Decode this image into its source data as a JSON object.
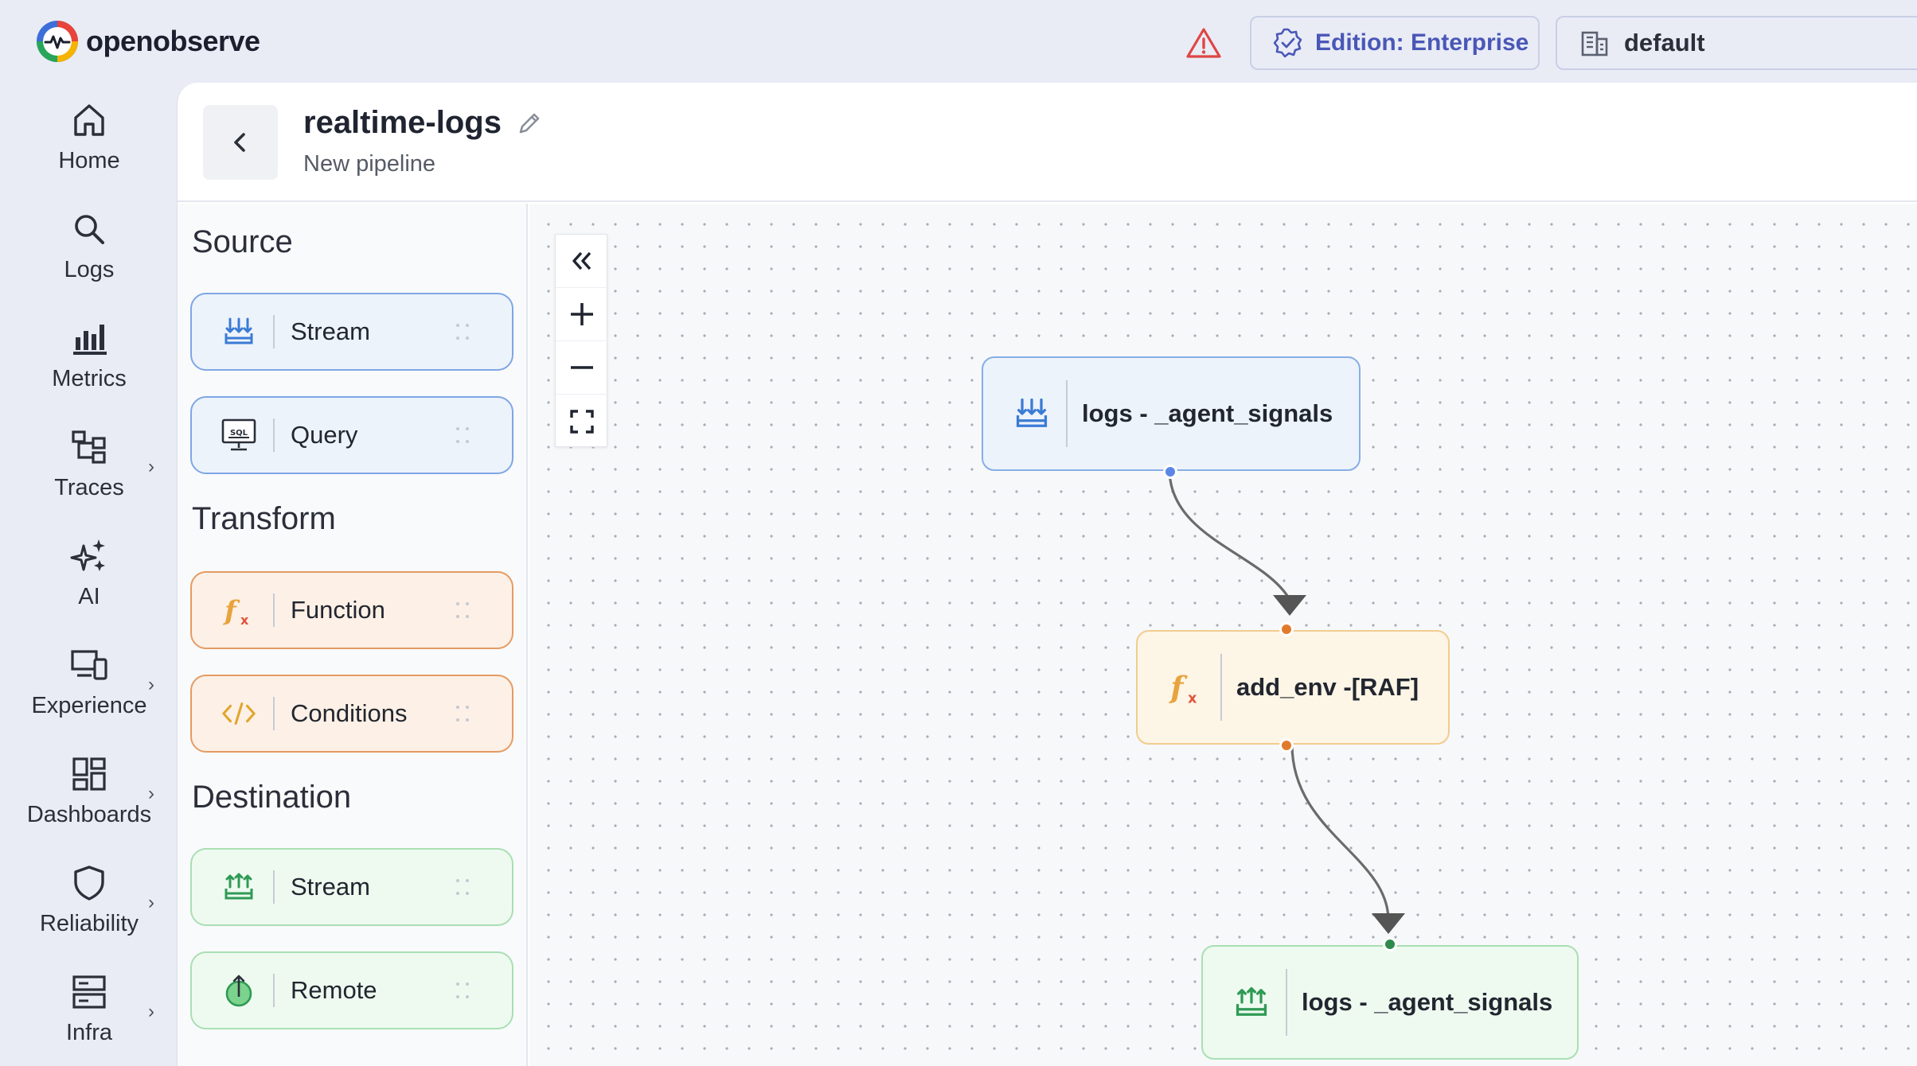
{
  "app": {
    "logo_text": "openobserve"
  },
  "topbar": {
    "alert_icon": "warning-triangle-icon",
    "edition_label": "Edition: Enterprise",
    "org_label": "default"
  },
  "nav": {
    "items": [
      {
        "label": "Home",
        "icon": "home-icon",
        "has_submenu": false
      },
      {
        "label": "Logs",
        "icon": "search-icon",
        "has_submenu": false
      },
      {
        "label": "Metrics",
        "icon": "bar-chart-icon",
        "has_submenu": false
      },
      {
        "label": "Traces",
        "icon": "traces-icon",
        "has_submenu": true
      },
      {
        "label": "AI",
        "icon": "sparkles-icon",
        "has_submenu": false
      },
      {
        "label": "Experience",
        "icon": "devices-icon",
        "has_submenu": true
      },
      {
        "label": "Dashboards",
        "icon": "dashboard-icon",
        "has_submenu": true
      },
      {
        "label": "Reliability",
        "icon": "shield-icon",
        "has_submenu": true
      },
      {
        "label": "Infra",
        "icon": "server-icon",
        "has_submenu": true
      }
    ]
  },
  "pipeline": {
    "title": "realtime-logs",
    "subtitle": "New pipeline"
  },
  "palette": {
    "source": {
      "title": "Source",
      "items": [
        {
          "label": "Stream"
        },
        {
          "label": "Query"
        }
      ]
    },
    "transform": {
      "title": "Transform",
      "items": [
        {
          "label": "Function"
        },
        {
          "label": "Conditions"
        }
      ]
    },
    "destination": {
      "title": "Destination",
      "items": [
        {
          "label": "Stream"
        },
        {
          "label": "Remote"
        }
      ]
    }
  },
  "canvas": {
    "nodes": [
      {
        "label": "logs - _agent_signals",
        "kind": "source-stream"
      },
      {
        "label": "add_env -[RAF]",
        "kind": "function"
      },
      {
        "label": "logs - _agent_signals",
        "kind": "destination-stream"
      }
    ]
  },
  "colors": {
    "source": "#7ea7e4",
    "transform": "#e59b63",
    "destination": "#a9dfb3",
    "accent": "#4a57b7",
    "edge": "#6b6b6b"
  }
}
